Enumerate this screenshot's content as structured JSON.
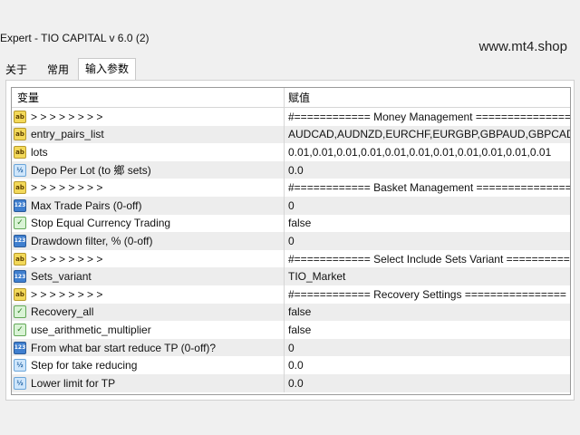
{
  "window": {
    "title": "Expert - TIO CAPITAL v 6.0 (2)",
    "watermark": "www.mt4.shop"
  },
  "tabs": [
    {
      "label": "关于"
    },
    {
      "label": "常用"
    },
    {
      "label": "输入参数"
    }
  ],
  "table": {
    "headers": {
      "name": "变量",
      "value": "赋值"
    },
    "rows": [
      {
        "icon": "ab",
        "name": ">  >  >  >  >  >  >  >",
        "value": "#============ Money Management ================",
        "shaded": false
      },
      {
        "icon": "ab",
        "name": "entry_pairs_list",
        "value": "AUDCAD,AUDNZD,EURCHF,EURGBP,GBPAUD,GBPCAD",
        "shaded": true
      },
      {
        "icon": "ab",
        "name": "lots",
        "value": "0.01,0.01,0.01,0.01,0.01,0.01,0.01,0.01,0.01,0.01,0.01",
        "shaded": false
      },
      {
        "icon": "half",
        "name": "Depo Per Lot (to 鄉 sets)",
        "value": "0.0",
        "shaded": true
      },
      {
        "icon": "ab",
        "name": ">  >  >  >  >  >  >  >",
        "value": "#============ Basket Management ================",
        "shaded": false
      },
      {
        "icon": "num",
        "name": "Max Trade Pairs (0-off)",
        "value": "0",
        "shaded": true
      },
      {
        "icon": "bool",
        "name": "Stop Equal Currency Trading",
        "value": "false",
        "shaded": false
      },
      {
        "icon": "num",
        "name": "Drawdown filter, % (0-off)",
        "value": "0",
        "shaded": true
      },
      {
        "icon": "ab",
        "name": ">  >  >  >  >  >  >  >",
        "value": "#============ Select Include Sets Variant ============",
        "shaded": false
      },
      {
        "icon": "num",
        "name": "Sets_variant",
        "value": "TIO_Market",
        "shaded": true
      },
      {
        "icon": "ab",
        "name": ">  >  >  >  >  >  >  >",
        "value": "#============ Recovery Settings ================",
        "shaded": false
      },
      {
        "icon": "bool",
        "name": "Recovery_all",
        "value": "false",
        "shaded": true
      },
      {
        "icon": "bool",
        "name": "use_arithmetic_multiplier",
        "value": "false",
        "shaded": false
      },
      {
        "icon": "num",
        "name": "From what bar start reduce TP (0-off)?",
        "value": "0",
        "shaded": true
      },
      {
        "icon": "half",
        "name": "Step for take reducing",
        "value": "0.0",
        "shaded": false
      },
      {
        "icon": "half",
        "name": "Lower limit for TP",
        "value": "0.0",
        "shaded": true
      }
    ]
  }
}
